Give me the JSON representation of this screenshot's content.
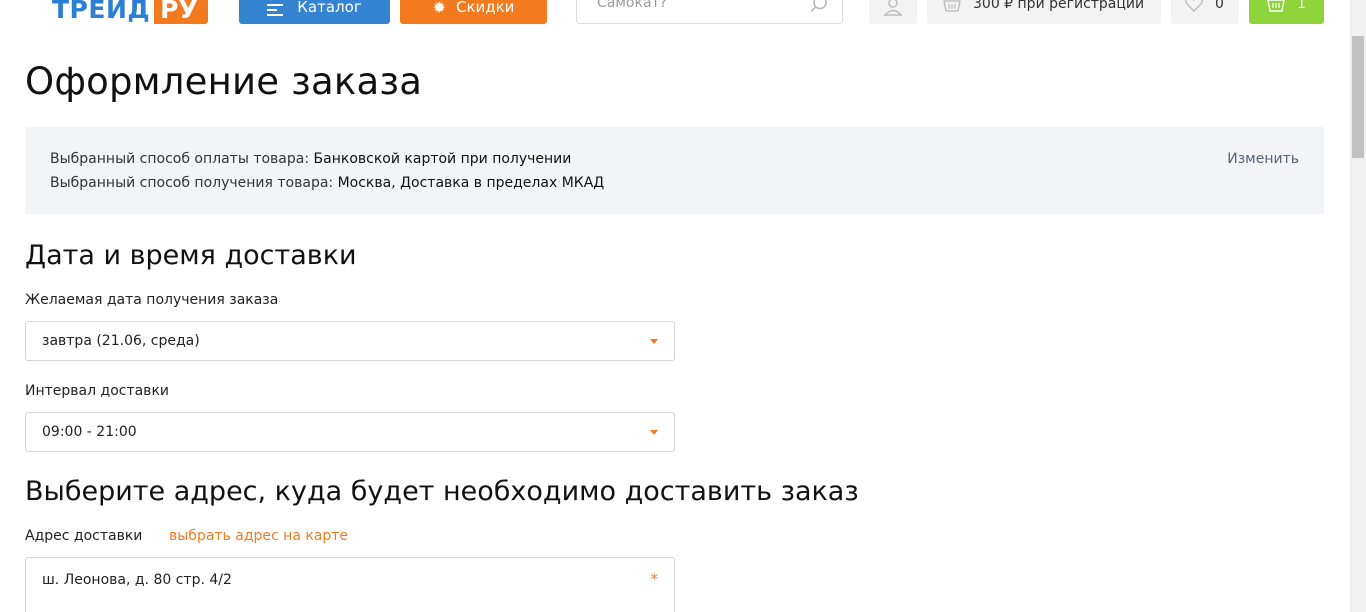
{
  "header": {
    "logo_text": "ТРЕЙД",
    "logo_box": "РУ",
    "catalog_label": "Каталог",
    "sale_label": "Скидки",
    "search_placeholder": "Самокат?",
    "bonus_label": "300 ₽ при регистрации",
    "favorites_count": "0",
    "cart_count": "1"
  },
  "page": {
    "title": "Оформление заказа"
  },
  "info": {
    "payment_prefix": "Выбранный способ оплаты товара: ",
    "payment_value": "Банковской картой при получении",
    "delivery_prefix": "Выбранный способ получения товара: ",
    "delivery_value": "Москва, Доставка в пределах МКАД",
    "change_label": "Изменить"
  },
  "delivery_time": {
    "heading": "Дата и время доставки",
    "date_label": "Желаемая дата получения заказа",
    "date_value": "завтра (21.06, среда)",
    "interval_label": "Интервал доставки",
    "interval_value": "09:00 - 21:00"
  },
  "address": {
    "heading": "Выберите адрес, куда будет необходимо доставить заказ",
    "label": "Адрес доставки",
    "map_link": "выбрать адрес на карте",
    "value": "ш. Леонова, д. 80 стр. 4/2",
    "required_mark": "*"
  },
  "colors": {
    "brand_blue": "#3383d1",
    "brand_orange": "#f47a20",
    "cart_green": "#8ed43b",
    "info_bg": "#f2f4f7"
  },
  "icons": [
    "menu-icon",
    "discount-badge-icon",
    "search-icon",
    "user-icon",
    "basket-icon",
    "heart-icon",
    "cart-icon",
    "dropdown-caret-icon"
  ]
}
